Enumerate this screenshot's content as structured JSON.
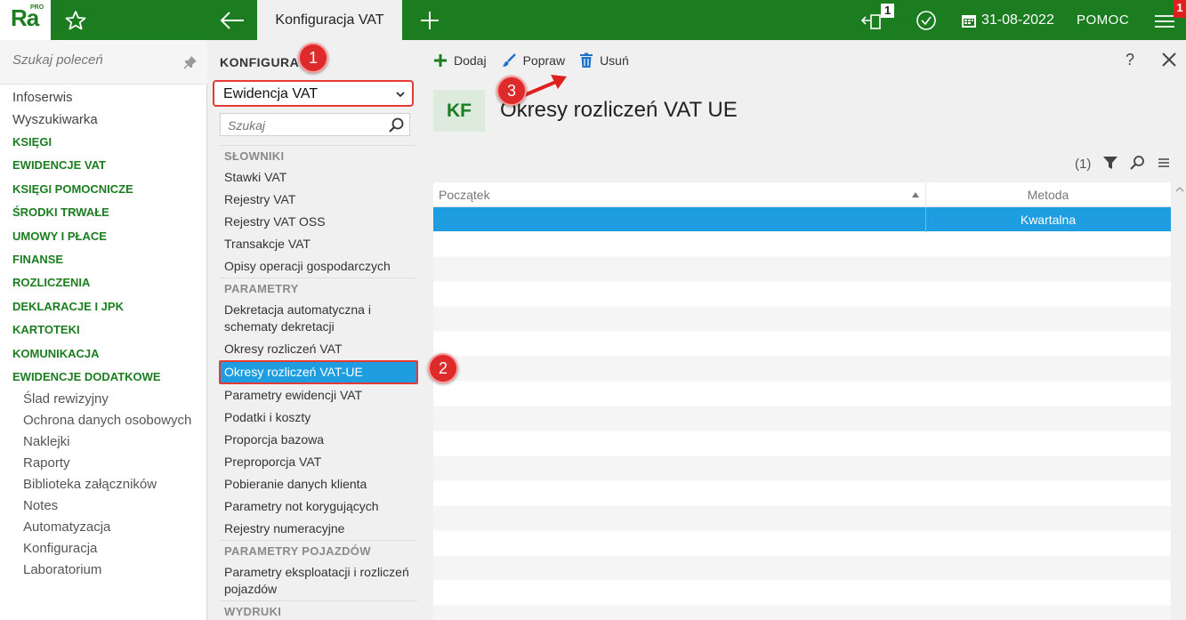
{
  "app": {
    "logo_text": "Ra",
    "logo_badge": "PRO",
    "active_tab": "Konfiguracja VAT",
    "notifications_count": "1",
    "date": "31-08-2022",
    "help": "POMOC",
    "alerts_count": "1",
    "brand_color": "#1b7d1f",
    "selection_color": "#1e9de0"
  },
  "leftnav": {
    "search_placeholder": "Szukaj poleceń",
    "items": [
      "Infoserwis",
      "Wyszukiwarka"
    ],
    "sections": [
      "KSIĘGI",
      "EWIDENCJE VAT",
      "KSIĘGI POMOCNICZE",
      "ŚRODKI TRWAŁE",
      "UMOWY I PŁACE",
      "FINANSE",
      "ROZLICZENIA",
      "DEKLARACJE I JPK",
      "KARTOTEKI",
      "KOMUNIKACJA",
      "EWIDENCJE DODATKOWE"
    ],
    "subitems": [
      "Ślad rewizyjny",
      "Ochrona danych osobowych",
      "Naklejki",
      "Raporty",
      "Biblioteka załączników",
      "Notes",
      "Automatyzacja",
      "Konfiguracja",
      "Laboratorium"
    ]
  },
  "config": {
    "title": "KONFIGURACJA",
    "selected": "Ewidencja VAT",
    "search_placeholder": "Szukaj",
    "headers": [
      "SŁOWNIKI",
      "PARAMETRY",
      "PARAMETRY POJAZDÓW",
      "WYDRUKI"
    ],
    "slowniki": [
      "Stawki VAT",
      "Rejestry VAT",
      "Rejestry VAT OSS",
      "Transakcje VAT",
      "Opisy operacji gospodarczych"
    ],
    "parametry": [
      "Dekretacja automatyczna i schematy dekretacji",
      "Okresy rozliczeń VAT",
      "Okresy rozliczeń VAT-UE",
      "Parametry ewidencji VAT",
      "Podatki i koszty",
      "Proporcja bazowa",
      "Preproporcja VAT",
      "Pobieranie danych klienta",
      "Parametry not korygujących",
      "Rejestry numeracyjne"
    ],
    "pojazdy": [
      "Parametry eksploatacji i rozliczeń pojazdów"
    ]
  },
  "toolbar": {
    "add": "Dodaj",
    "edit": "Popraw",
    "delete": "Usuń",
    "help": "?"
  },
  "main": {
    "badge": "KF",
    "title": "Okresy rozliczeń VAT UE",
    "count": "(1)",
    "columns": [
      "Początek",
      "Metoda"
    ],
    "rows": [
      {
        "poczatek": "",
        "metoda": "Kwartalna"
      }
    ]
  },
  "callouts": [
    "1",
    "2",
    "3"
  ]
}
